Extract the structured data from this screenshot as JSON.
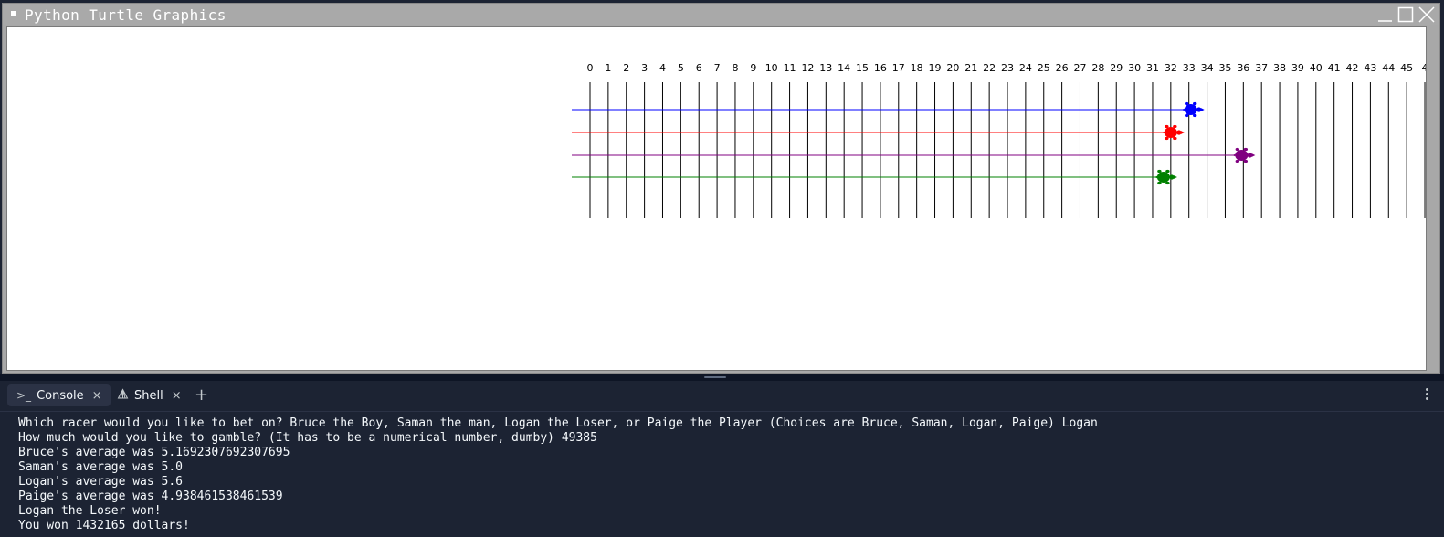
{
  "window": {
    "title": "Python Turtle Graphics"
  },
  "race": {
    "lane_labels": [
      "0",
      "1",
      "2",
      "3",
      "4",
      "5",
      "6",
      "7",
      "8",
      "9",
      "10",
      "11",
      "12",
      "13",
      "14",
      "15",
      "16",
      "17",
      "18",
      "19",
      "20",
      "21",
      "22",
      "23",
      "24",
      "25",
      "26",
      "27",
      "28",
      "29",
      "30",
      "31",
      "32",
      "33",
      "34",
      "35",
      "36",
      "37",
      "38",
      "39",
      "40",
      "41",
      "42",
      "43",
      "44",
      "45",
      "4"
    ],
    "turtles": [
      {
        "name": "blue-turtle",
        "color": "#0000ff",
        "position": 33.1
      },
      {
        "name": "red-turtle",
        "color": "#ff0000",
        "position": 32.0
      },
      {
        "name": "purple-turtle",
        "color": "#800080",
        "position": 35.9
      },
      {
        "name": "green-turtle",
        "color": "#008000",
        "position": 31.6
      }
    ]
  },
  "console": {
    "tabs": [
      {
        "label": "Console",
        "icon": "terminal-prompt-icon"
      },
      {
        "label": "Shell",
        "icon": "shell-icon"
      }
    ],
    "lines": [
      "Which racer would you like to bet on? Bruce the Boy, Saman the man, Logan the Loser, or Paige the Player (Choices are Bruce, Saman, Logan, Paige) Logan",
      "How much would you like to gamble? (It has to be a numerical number, dumby) 49385",
      "Bruce's average was 5.1692307692307695",
      "Saman's average was 5.0",
      "Logan's average was 5.6",
      "Paige's average was 4.938461538461539",
      "Logan the Loser won!",
      "You won 1432165 dollars!"
    ]
  }
}
